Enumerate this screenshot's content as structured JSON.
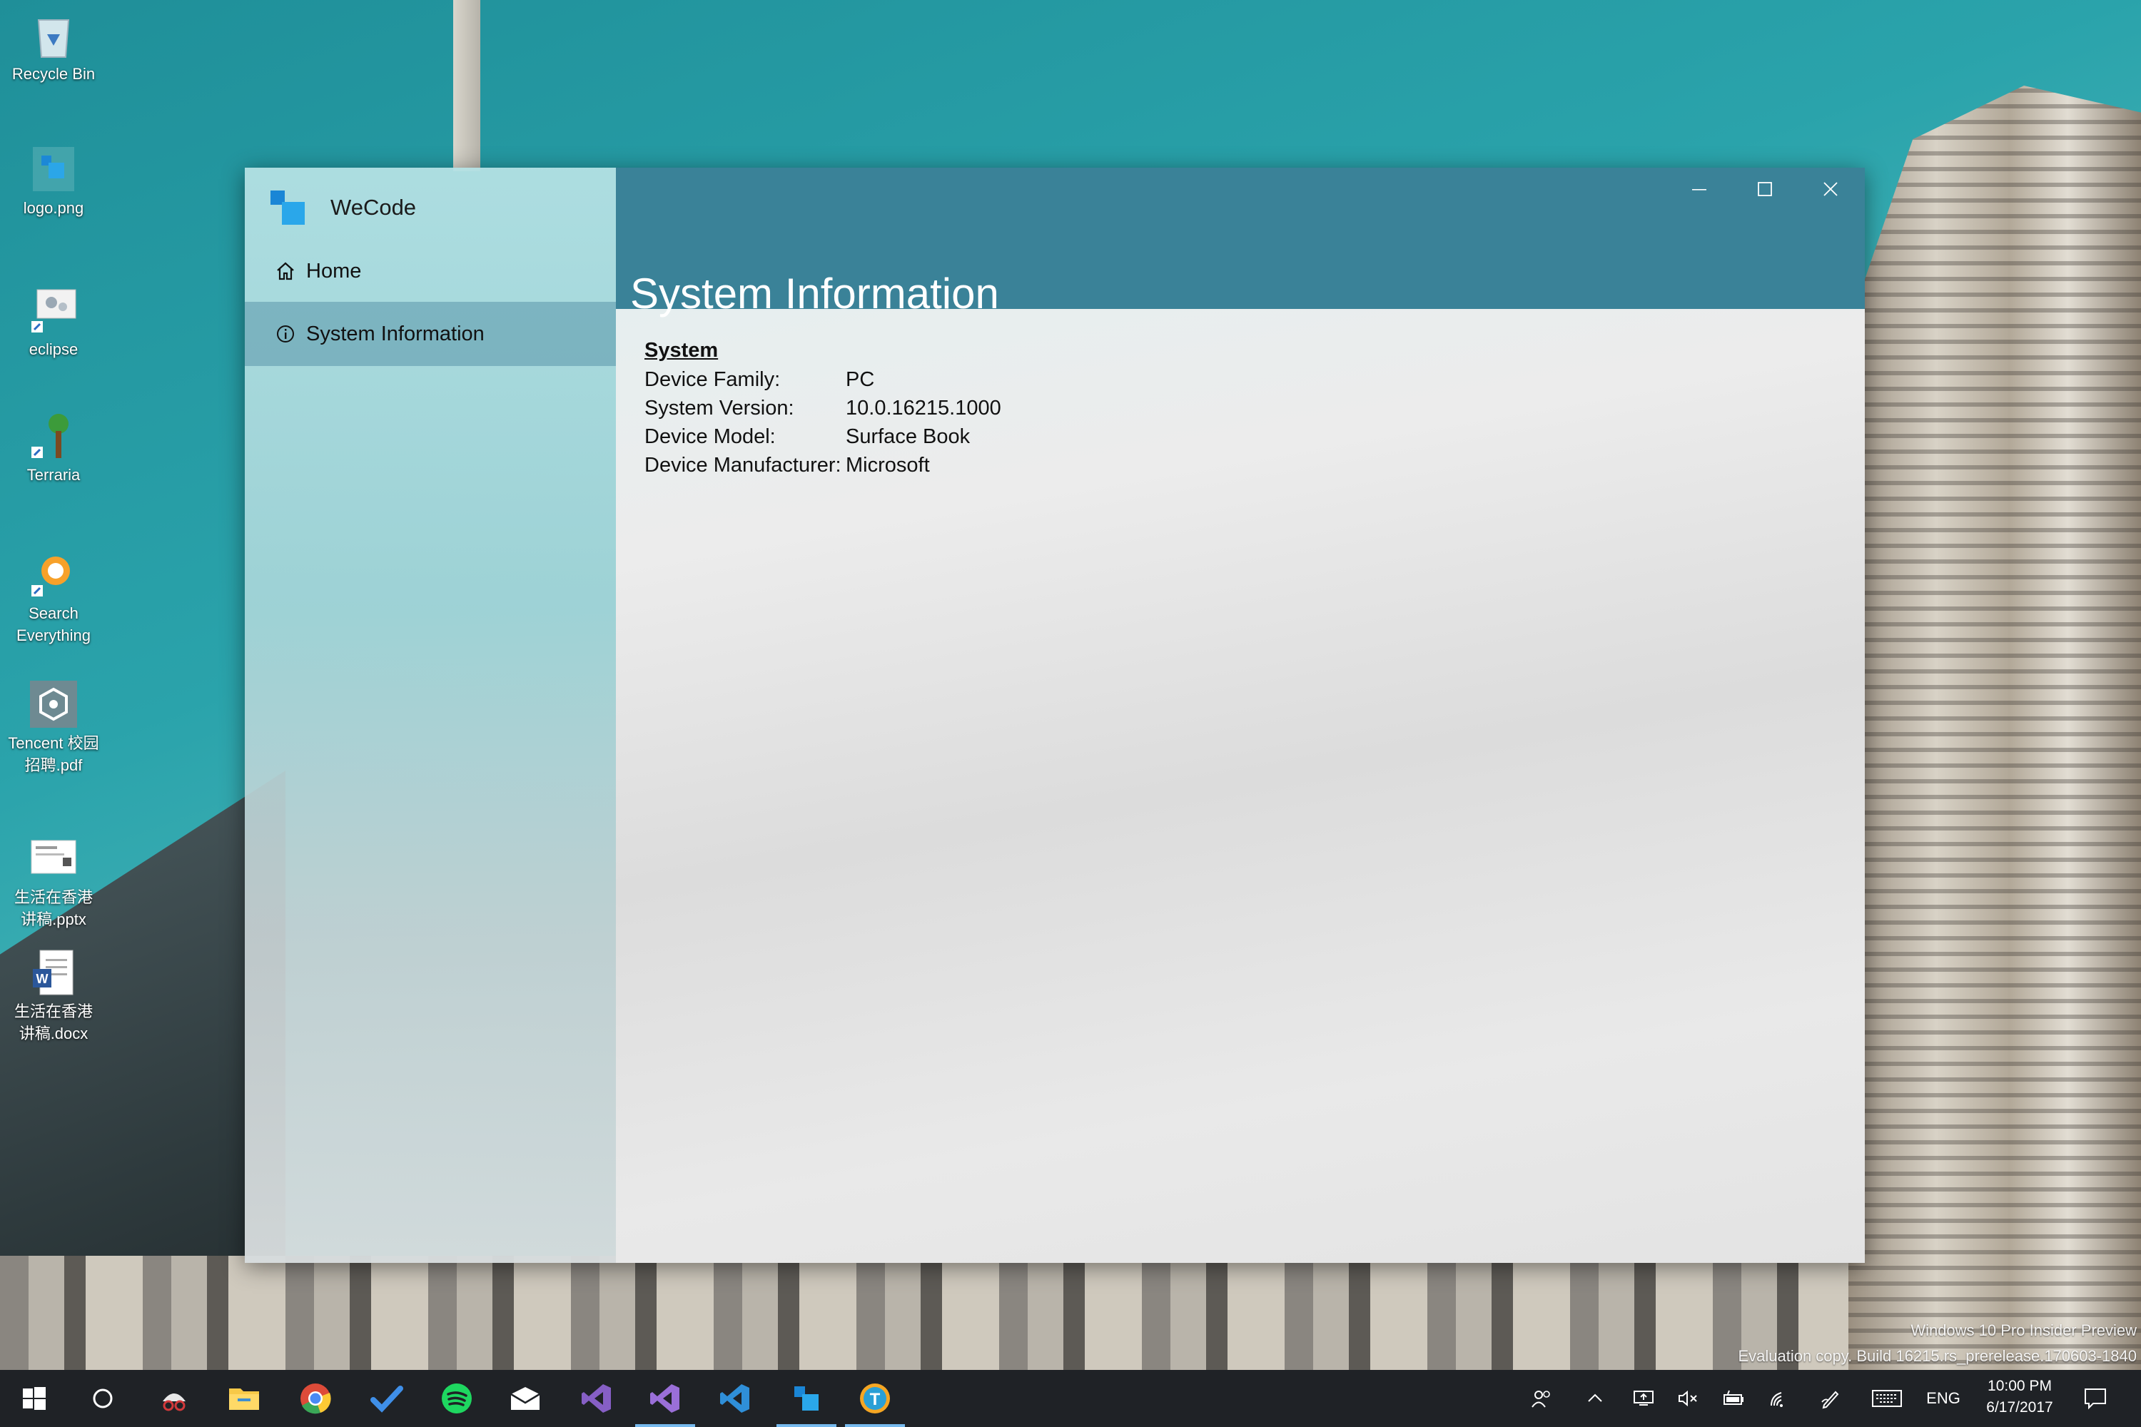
{
  "desktop": {
    "icons": [
      {
        "label": "Recycle Bin"
      },
      {
        "label": "logo.png"
      },
      {
        "label": "eclipse"
      },
      {
        "label": "Terraria"
      },
      {
        "label": "Search\nEverything"
      },
      {
        "label": "Tencent 校园\n招聘.pdf"
      },
      {
        "label": "生活在香港\n讲稿.pptx"
      },
      {
        "label": "生活在香港\n讲稿.docx"
      }
    ],
    "watermark_line1": "Windows 10 Pro Insider Preview",
    "watermark_line2": "Evaluation copy. Build 16215.rs_prerelease.170603-1840"
  },
  "app": {
    "name": "WeCode",
    "accent": "#3a8298",
    "nav": {
      "header_buttons": [
        {
          "icon": "feedback-icon"
        },
        {
          "icon": "gear-icon"
        }
      ],
      "items": [
        {
          "label": "Home",
          "icon": "home-icon",
          "selected": false
        },
        {
          "label": "System Information",
          "icon": "info-icon",
          "selected": true
        }
      ]
    },
    "page_title": "System Information",
    "caption_buttons": [
      "minimize",
      "maximize",
      "close"
    ],
    "system": {
      "section_title": "System",
      "rows": [
        {
          "key": "Device Family:",
          "value": "PC"
        },
        {
          "key": "System Version:",
          "value": "10.0.16215.1000"
        },
        {
          "key": "Device Model:",
          "value": "Surface Book"
        },
        {
          "key": "Device Manufacturer:",
          "value": "Microsoft"
        }
      ]
    }
  },
  "taskbar": {
    "apps": [
      {
        "name": "start",
        "icon": "windows-logo-icon"
      },
      {
        "name": "cortana",
        "icon": "cortana-icon"
      },
      {
        "name": "snipping",
        "icon": "snipping-tool-icon"
      },
      {
        "name": "file-explorer",
        "icon": "folder-icon"
      },
      {
        "name": "chrome",
        "icon": "chrome-icon"
      },
      {
        "name": "todo",
        "icon": "checkmark-icon"
      },
      {
        "name": "spotify",
        "icon": "spotify-icon"
      },
      {
        "name": "mail",
        "icon": "mail-icon"
      },
      {
        "name": "visual-studio",
        "icon": "visual-studio-icon"
      },
      {
        "name": "visual-studio-2",
        "icon": "visual-studio-icon"
      },
      {
        "name": "vscode",
        "icon": "vscode-icon"
      },
      {
        "name": "wecode",
        "icon": "wecode-icon"
      },
      {
        "name": "typora",
        "icon": "typora-icon"
      }
    ],
    "language": "ENG",
    "time": "10:00 PM",
    "date": "6/17/2017"
  }
}
